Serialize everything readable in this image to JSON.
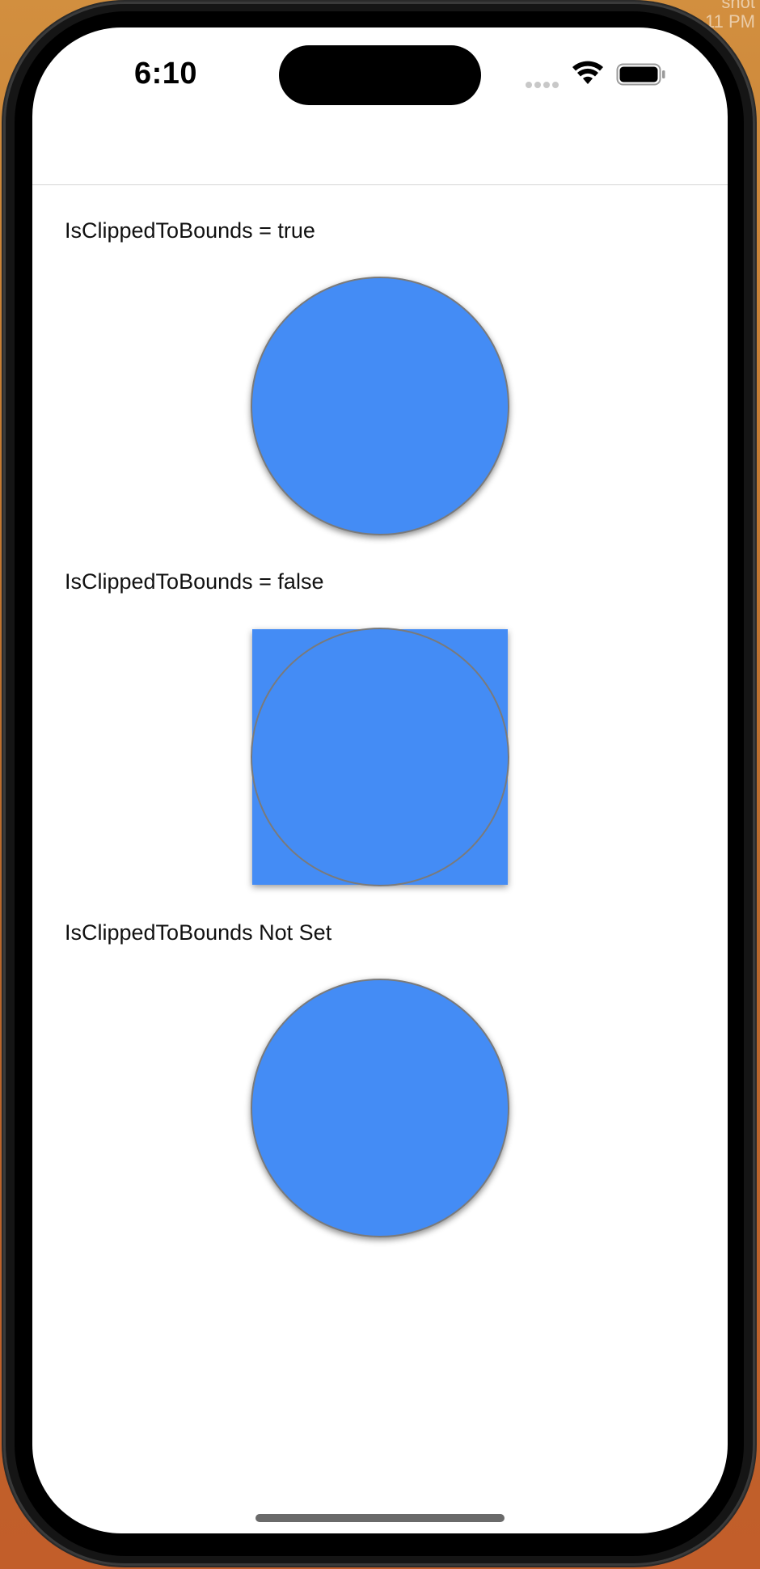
{
  "desktop": {
    "label_line1": "shot",
    "label_line2": "11 PM"
  },
  "status_bar": {
    "time": "6:10",
    "icons": [
      "cellular-signal-icon",
      "wifi-icon",
      "battery-icon"
    ]
  },
  "sections": [
    {
      "label": "IsClippedToBounds = true",
      "shape": "clipped-circle"
    },
    {
      "label": "IsClippedToBounds = false",
      "shape": "square-with-circle-outline"
    },
    {
      "label": "IsClippedToBounds Not Set",
      "shape": "clipped-circle"
    }
  ],
  "colors": {
    "shape_fill": "#448cf5",
    "border": "#7a7a7a",
    "screen_bg": "#ffffff",
    "text": "#111111"
  }
}
